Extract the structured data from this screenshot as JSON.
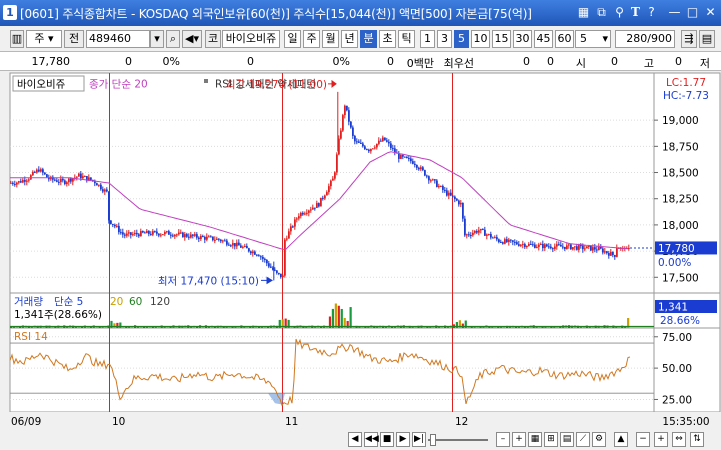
{
  "window": {
    "number": "1",
    "title": "[0601] 주식종합차트 - KOSDAQ 외국인보유[60(천)] 주식수[15,044(천)] 액면[500] 자본금[75(억)]",
    "title_icons": [
      "layout-icon",
      "restore-icon",
      "pin-icon",
      "font-icon",
      "minimize-icon",
      "maximize-icon",
      "close-icon"
    ]
  },
  "toolbar": {
    "market": "주",
    "prev": "전",
    "code": "489460",
    "stock_type": "코",
    "stock_name": "바이오비쥬",
    "periods": [
      "일",
      "주",
      "월",
      "년",
      "분",
      "초",
      "틱"
    ],
    "active_period": "분",
    "intervals": [
      "1",
      "3",
      "5",
      "10",
      "15",
      "30",
      "45",
      "60"
    ],
    "active_interval": "5",
    "interval_select": "5",
    "count": "280",
    "count_total": "/900"
  },
  "info_row": {
    "price": "17,780",
    "v1": "0",
    "p1": "0%",
    "v2": "0",
    "p2": "0%",
    "v3": "0",
    "pre_label": "0백만",
    "best_ask_label": "최우선",
    "v4": "0",
    "v5": "0",
    "open_label": "시",
    "open": "0",
    "high_label": "고",
    "high": "0",
    "low_label": "저"
  },
  "price_panel": {
    "stock_label": "바이오비쥬",
    "ma_label": "종가 단순 20",
    "pattern_label": "RSI 강세패턴   약세패턴",
    "lc": "LC:1.77",
    "hc": "HC:-7.73",
    "high_marker": "최고 19,270 (11:00)",
    "low_marker": "최저 17,470 (15:10)",
    "current_price": "17,780",
    "current_pct": "0.00%",
    "y_ticks": [
      "19,000",
      "18,750",
      "18,500",
      "18,250",
      "18,000",
      "17,750",
      "17,500"
    ],
    "accent_up": "#e02020",
    "accent_down": "#1a3cd0",
    "ma_color": "#c040c0"
  },
  "chart_data": {
    "type": "candlestick",
    "title": "",
    "ylim": [
      17350,
      19450
    ],
    "x_labels": [
      "06/09",
      "10",
      "11",
      "12"
    ],
    "session_markers": [
      "10",
      "11",
      "12"
    ],
    "current": 17780,
    "high": {
      "value": 19270,
      "time": "11:00"
    },
    "low": {
      "value": 17470,
      "time": "15:10"
    },
    "price_path_anchors": [
      [
        0,
        18400
      ],
      [
        10,
        18410
      ],
      [
        20,
        18450
      ],
      [
        30,
        18530
      ],
      [
        40,
        18440
      ],
      [
        55,
        18410
      ],
      [
        70,
        18470
      ],
      [
        85,
        18420
      ],
      [
        99,
        18300
      ],
      [
        100,
        18050
      ],
      [
        115,
        17900
      ],
      [
        135,
        17920
      ],
      [
        160,
        17920
      ],
      [
        185,
        17890
      ],
      [
        210,
        17860
      ],
      [
        230,
        17800
      ],
      [
        250,
        17720
      ],
      [
        268,
        17530
      ],
      [
        275,
        17500
      ],
      [
        276,
        17860
      ],
      [
        290,
        18100
      ],
      [
        310,
        18200
      ],
      [
        325,
        18450
      ],
      [
        330,
        18800
      ],
      [
        336,
        19150
      ],
      [
        345,
        18800
      ],
      [
        360,
        18720
      ],
      [
        375,
        18820
      ],
      [
        390,
        18650
      ],
      [
        405,
        18600
      ],
      [
        420,
        18450
      ],
      [
        438,
        18300
      ],
      [
        452,
        18200
      ],
      [
        456,
        17900
      ],
      [
        470,
        17950
      ],
      [
        490,
        17850
      ],
      [
        510,
        17820
      ],
      [
        530,
        17800
      ],
      [
        560,
        17790
      ],
      [
        590,
        17770
      ],
      [
        605,
        17710
      ],
      [
        620,
        17780
      ]
    ],
    "ma_path_anchors": [
      [
        0,
        18450
      ],
      [
        60,
        18450
      ],
      [
        99,
        18400
      ],
      [
        130,
        18150
      ],
      [
        200,
        17980
      ],
      [
        275,
        17760
      ],
      [
        290,
        17900
      ],
      [
        330,
        18250
      ],
      [
        360,
        18600
      ],
      [
        380,
        18700
      ],
      [
        420,
        18620
      ],
      [
        452,
        18450
      ],
      [
        500,
        18000
      ],
      [
        560,
        17820
      ],
      [
        620,
        17770
      ]
    ]
  },
  "volume_panel": {
    "label": "거래량",
    "ma_label": "단순 5",
    "ma_periods": [
      "20",
      "60",
      "120"
    ],
    "ma_colors": [
      "#c8a000",
      "#208020",
      "#404040"
    ],
    "value_text": "1,341주(28.66%)",
    "current_value": "1,341",
    "current_pct": "28.66%",
    "ylim": [
      0,
      4700
    ],
    "bars_per_session": 78,
    "last_volume": 1341
  },
  "rsi_panel": {
    "label": "RSI 14",
    "y_ticks": [
      "75.00",
      "50.00",
      "25.00"
    ],
    "ylim": [
      15,
      82
    ],
    "rsi_color": "#d07820",
    "guide_levels": [
      70,
      30
    ],
    "path_anchors": [
      [
        0,
        58
      ],
      [
        15,
        55
      ],
      [
        30,
        62
      ],
      [
        45,
        55
      ],
      [
        60,
        48
      ],
      [
        75,
        60
      ],
      [
        90,
        52
      ],
      [
        100,
        54
      ],
      [
        106,
        38
      ],
      [
        110,
        28
      ],
      [
        125,
        42
      ],
      [
        145,
        44
      ],
      [
        165,
        40
      ],
      [
        185,
        46
      ],
      [
        205,
        42
      ],
      [
        225,
        46
      ],
      [
        245,
        42
      ],
      [
        262,
        38
      ],
      [
        272,
        22
      ],
      [
        283,
        25
      ],
      [
        286,
        70
      ],
      [
        300,
        66
      ],
      [
        320,
        62
      ],
      [
        340,
        68
      ],
      [
        360,
        58
      ],
      [
        380,
        55
      ],
      [
        400,
        62
      ],
      [
        420,
        56
      ],
      [
        440,
        50
      ],
      [
        452,
        46
      ],
      [
        455,
        20
      ],
      [
        470,
        44
      ],
      [
        490,
        50
      ],
      [
        510,
        46
      ],
      [
        530,
        48
      ],
      [
        550,
        44
      ],
      [
        570,
        46
      ],
      [
        590,
        42
      ],
      [
        610,
        49
      ],
      [
        620,
        58
      ]
    ]
  },
  "time_axis": {
    "labels": [
      "06/09",
      "10",
      "11",
      "12"
    ],
    "right_label": "15:35:00"
  },
  "bottom_bar": {
    "icons": [
      "scroll-start-icon",
      "scroll-prev-icon",
      "stop-icon",
      "scroll-next-icon",
      "zoom-slider-icon",
      "zoom-out-icon",
      "zoom-in-icon",
      "grid-icon",
      "chart-icon",
      "settings-icon",
      "expand-icon"
    ]
  }
}
